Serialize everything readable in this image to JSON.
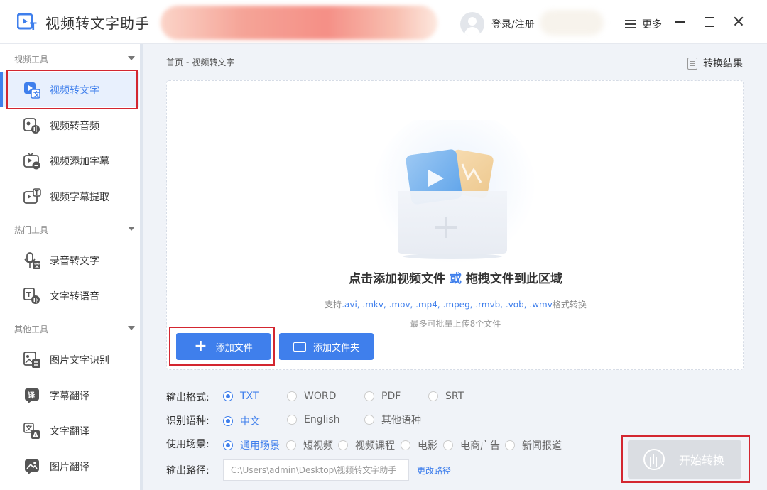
{
  "app": {
    "title": "视频转文字助手"
  },
  "titlebar": {
    "login": "登录/注册",
    "more": "更多"
  },
  "sidebar": {
    "groups": [
      {
        "label": "视频工具",
        "items": [
          {
            "label": "视频转文字"
          },
          {
            "label": "视频转音频"
          },
          {
            "label": "视频添加字幕"
          },
          {
            "label": "视频字幕提取"
          }
        ]
      },
      {
        "label": "热门工具",
        "items": [
          {
            "label": "录音转文字"
          },
          {
            "label": "文字转语音"
          }
        ]
      },
      {
        "label": "其他工具",
        "items": [
          {
            "label": "图片文字识别"
          },
          {
            "label": "字幕翻译"
          },
          {
            "label": "文字翻译"
          },
          {
            "label": "图片翻译"
          }
        ]
      }
    ],
    "active": "视频转文字"
  },
  "breadcrumb": {
    "home": "首页",
    "sep": "-",
    "current": "视频转文字"
  },
  "result_link": "转换结果",
  "dropzone": {
    "title_a": "点击添加视频文件",
    "title_or": "或",
    "title_b": "拖拽文件到此区域",
    "support_prefix": "支持",
    "support_formats": ".avi, .mkv, .mov, .mp4, .mpeg, .rmvb, .vob, .wmv",
    "support_suffix": "格式转换",
    "limit": "最多可批量上传8个文件"
  },
  "buttons": {
    "add_file": "添加文件",
    "add_folder": "添加文件夹",
    "start": "开始转换",
    "change_path": "更改路径"
  },
  "options": {
    "format": {
      "label": "输出格式:",
      "choices": [
        "TXT",
        "WORD",
        "PDF",
        "SRT"
      ],
      "selected": "TXT"
    },
    "language": {
      "label": "识别语种:",
      "choices": [
        "中文",
        "English",
        "其他语种"
      ],
      "selected": "中文"
    },
    "scene": {
      "label": "使用场景:",
      "choices": [
        "通用场景",
        "短视频",
        "视频课程",
        "电影",
        "电商广告",
        "新闻报道"
      ],
      "selected": "通用场景"
    },
    "output_path": {
      "label": "输出路径:",
      "value": "C:\\Users\\admin\\Desktop\\视频转文字助手"
    }
  },
  "colors": {
    "accent": "#3f7fec",
    "highlight": "#d32630",
    "disabled": "#dadde2"
  }
}
